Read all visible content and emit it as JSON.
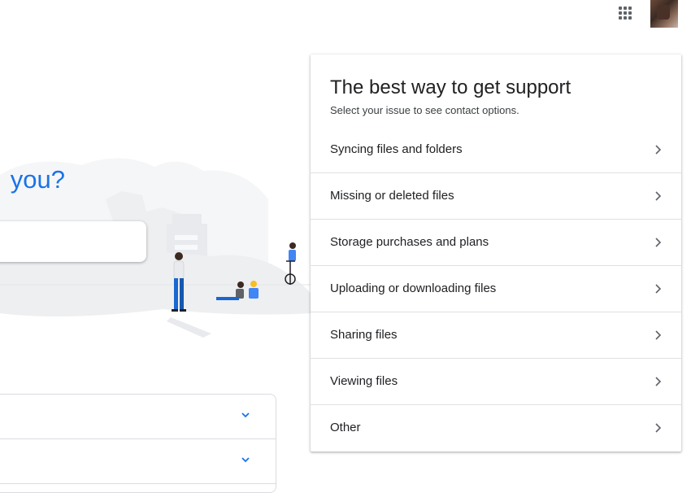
{
  "header": {
    "apps_icon": "apps-grid-icon",
    "avatar_icon": "account-avatar"
  },
  "hero": {
    "title": "you?"
  },
  "support_card": {
    "title": "The best way to get support",
    "subtitle": "Select your issue to see contact options.",
    "options": [
      {
        "label": "Syncing files and folders"
      },
      {
        "label": "Missing or deleted files"
      },
      {
        "label": "Storage purchases and plans"
      },
      {
        "label": "Uploading or downloading files"
      },
      {
        "label": "Sharing files"
      },
      {
        "label": "Viewing files"
      },
      {
        "label": "Other"
      }
    ]
  },
  "colors": {
    "accent": "#1a73e8",
    "text": "#202124",
    "divider": "#e0e0e0"
  }
}
